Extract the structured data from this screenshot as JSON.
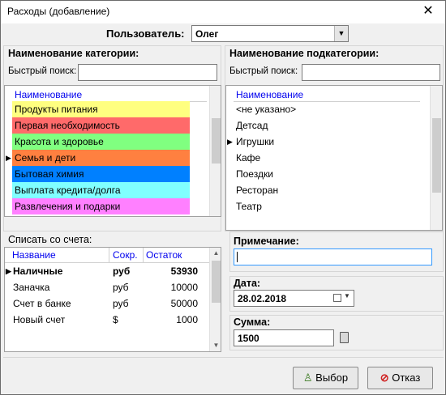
{
  "window": {
    "title": "Расходы (добавление)",
    "close_glyph": "✕"
  },
  "user": {
    "label": "Пользователь:",
    "value": "Олег"
  },
  "categories": {
    "title": "Наименование категории:",
    "search_label": "Быстрый поиск:",
    "search_value": "",
    "header": "Наименование",
    "items": [
      {
        "label": "Продукты питания",
        "color": "#ffff80"
      },
      {
        "label": "Первая необходимость",
        "color": "#ff6a6a"
      },
      {
        "label": "Красота и здоровье",
        "color": "#80ff80"
      },
      {
        "label": "Семья и дети",
        "color": "#ff8040",
        "current": true
      },
      {
        "label": "Бытовая химия",
        "color": "#0080ff"
      },
      {
        "label": "Выплата кредита/долга",
        "color": "#80ffff"
      },
      {
        "label": "Развлечения и подарки",
        "color": "#ff80ff"
      }
    ]
  },
  "subcategories": {
    "title": "Наименование подкатегории:",
    "search_label": "Быстрый поиск:",
    "search_value": "",
    "header": "Наименование",
    "items": [
      {
        "label": "<не указано>"
      },
      {
        "label": "Детсад"
      },
      {
        "label": "Игрушки",
        "current": true
      },
      {
        "label": "Кафе"
      },
      {
        "label": "Поездки"
      },
      {
        "label": "Ресторан"
      },
      {
        "label": "Театр"
      }
    ]
  },
  "accounts": {
    "title": "Списать со счета:",
    "headers": {
      "name": "Название",
      "short": "Сокр.",
      "balance": "Остаток"
    },
    "rows": [
      {
        "name": "Наличные",
        "short": "руб",
        "balance": "53930",
        "current": true
      },
      {
        "name": "Заначка",
        "short": "руб",
        "balance": "10000"
      },
      {
        "name": "Счет в банке",
        "short": "руб",
        "balance": "50000"
      },
      {
        "name": "Новый счет",
        "short": "$",
        "balance": "1000"
      }
    ]
  },
  "note": {
    "label": "Примечание:",
    "value": ""
  },
  "date": {
    "label": "Дата:",
    "value": "28.02.2018"
  },
  "amount": {
    "label": "Сумма:",
    "value": "1500"
  },
  "buttons": {
    "select": "Выбор",
    "cancel": "Отказ"
  },
  "colors": {
    "header_link": "#0000ee",
    "selected_category": "#ff8040"
  }
}
